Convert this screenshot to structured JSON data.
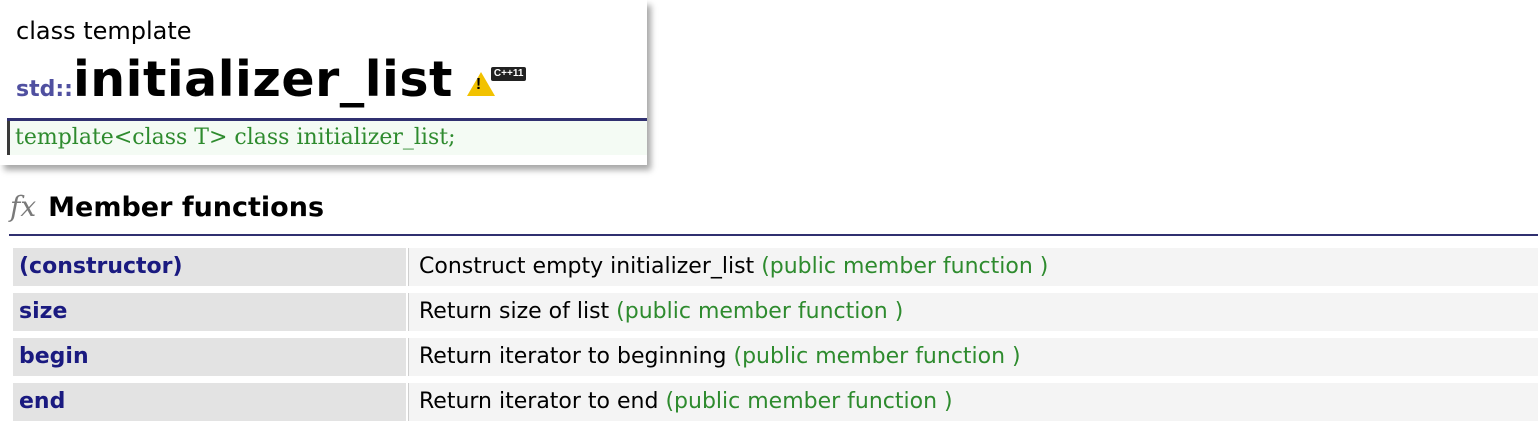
{
  "header": {
    "kind": "class template",
    "namespace": "std::",
    "name": "initializer_list",
    "badge_label": "C++11",
    "declaration": "template<class T> class initializer_list;",
    "badge_color": "#f2c200",
    "namespace_color": "#5050a0",
    "declaration_color": "#2e8b2e"
  },
  "section": {
    "icon": "fx",
    "title": "Member functions"
  },
  "members": [
    {
      "name": "(constructor)",
      "desc": "Construct empty initializer_list",
      "tag": "(public member function )"
    },
    {
      "name": "size",
      "desc": "Return size of list",
      "tag": "(public member function )"
    },
    {
      "name": "begin",
      "desc": "Return iterator to beginning",
      "tag": "(public member function )"
    },
    {
      "name": "end",
      "desc": "Return iterator to end",
      "tag": "(public member function )"
    }
  ]
}
